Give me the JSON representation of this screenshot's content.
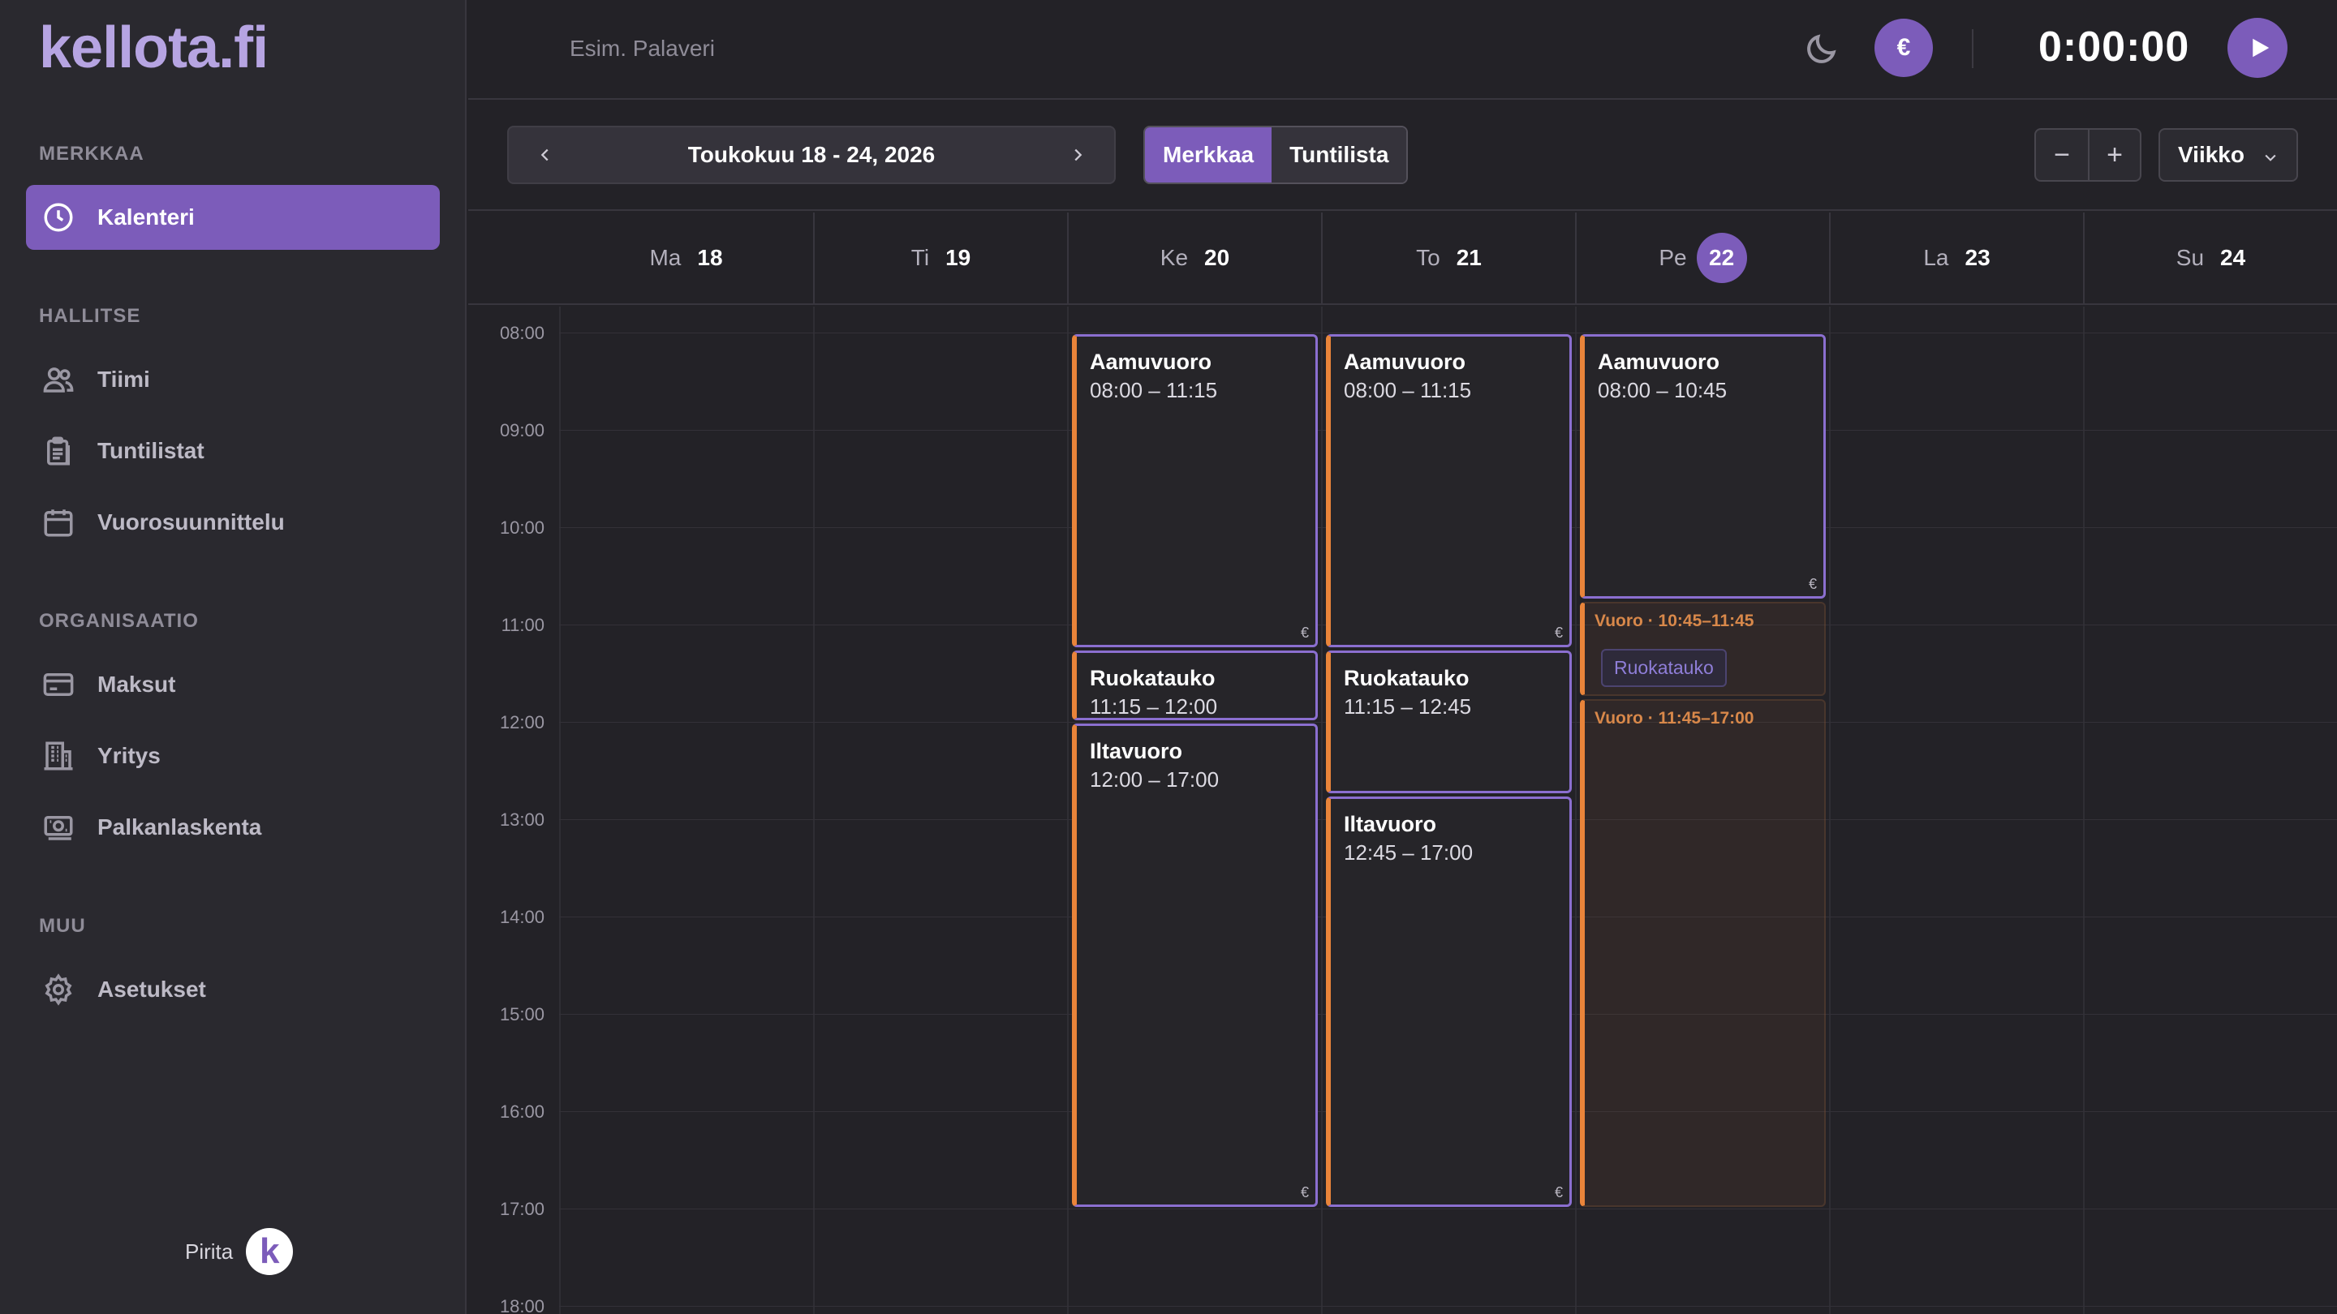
{
  "app": {
    "logo": "kellota.fi",
    "task_placeholder": "Esim. Palaveri",
    "euro_symbol": "€",
    "timer": "0:00:00"
  },
  "sidebar": {
    "sections": [
      {
        "title": "MERKKAA",
        "items": [
          {
            "label": "Kalenteri",
            "icon": "clock-icon",
            "active": true
          }
        ]
      },
      {
        "title": "HALLITSE",
        "items": [
          {
            "label": "Tiimi",
            "icon": "team-icon"
          },
          {
            "label": "Tuntilistat",
            "icon": "clipboard-icon"
          },
          {
            "label": "Vuorosuunnittelu",
            "icon": "calendar-icon"
          }
        ]
      },
      {
        "title": "ORGANISAATIO",
        "items": [
          {
            "label": "Maksut",
            "icon": "credit-card-icon"
          },
          {
            "label": "Yritys",
            "icon": "building-icon"
          },
          {
            "label": "Palkanlaskenta",
            "icon": "money-icon"
          }
        ]
      },
      {
        "title": "MUU",
        "items": [
          {
            "label": "Asetukset",
            "icon": "gear-icon"
          }
        ]
      }
    ],
    "user": {
      "name": "Pirita",
      "avatar_letter": "k"
    }
  },
  "toolbar": {
    "date_range": "Toukokuu 18 - 24, 2026",
    "tabs": [
      {
        "label": "Merkkaa",
        "active": true
      },
      {
        "label": "Tuntilista",
        "active": false
      }
    ],
    "zoom_out": "−",
    "zoom_in": "+",
    "view": "Viikko"
  },
  "calendar": {
    "days": [
      {
        "name": "Ma",
        "num": "18",
        "today": false
      },
      {
        "name": "Ti",
        "num": "19",
        "today": false
      },
      {
        "name": "Ke",
        "num": "20",
        "today": false
      },
      {
        "name": "To",
        "num": "21",
        "today": false
      },
      {
        "name": "Pe",
        "num": "22",
        "today": true
      },
      {
        "name": "La",
        "num": "23",
        "today": false
      },
      {
        "name": "Su",
        "num": "24",
        "today": false
      }
    ],
    "hours": [
      "08:00",
      "09:00",
      "10:00",
      "11:00",
      "12:00",
      "13:00",
      "14:00",
      "15:00",
      "16:00",
      "17:00",
      "18:00"
    ],
    "events": [
      {
        "day": 2,
        "start": 8.0,
        "end": 11.25,
        "title": "Aamuvuoro",
        "time": "08:00 – 11:15",
        "euro": true
      },
      {
        "day": 2,
        "start": 11.25,
        "end": 12.0,
        "title": "Ruokatauko",
        "time": "11:15 – 12:00",
        "euro": false
      },
      {
        "day": 2,
        "start": 12.0,
        "end": 17.0,
        "title": "Iltavuoro",
        "time": "12:00 – 17:00",
        "euro": true
      },
      {
        "day": 3,
        "start": 8.0,
        "end": 11.25,
        "title": "Aamuvuoro",
        "time": "08:00 – 11:15",
        "euro": true
      },
      {
        "day": 3,
        "start": 11.25,
        "end": 12.75,
        "title": "Ruokatauko",
        "time": "11:15 – 12:45",
        "euro": false
      },
      {
        "day": 3,
        "start": 12.75,
        "end": 17.0,
        "title": "Iltavuoro",
        "time": "12:45 – 17:00",
        "euro": true
      },
      {
        "day": 4,
        "start": 8.0,
        "end": 10.75,
        "title": "Aamuvuoro",
        "time": "08:00 – 10:45",
        "euro": true
      }
    ],
    "shifts": [
      {
        "day": 4,
        "start": 10.75,
        "end": 11.75,
        "label": "Vuoro · 10:45–11:45",
        "badge": "Ruokatauko"
      },
      {
        "day": 4,
        "start": 11.75,
        "end": 17.0,
        "label": "Vuoro · 11:45–17:00",
        "badge": ""
      }
    ]
  },
  "colors": {
    "accent": "#7c5cba",
    "shift_border": "#e9843a",
    "event_border": "#8b6fd0"
  }
}
